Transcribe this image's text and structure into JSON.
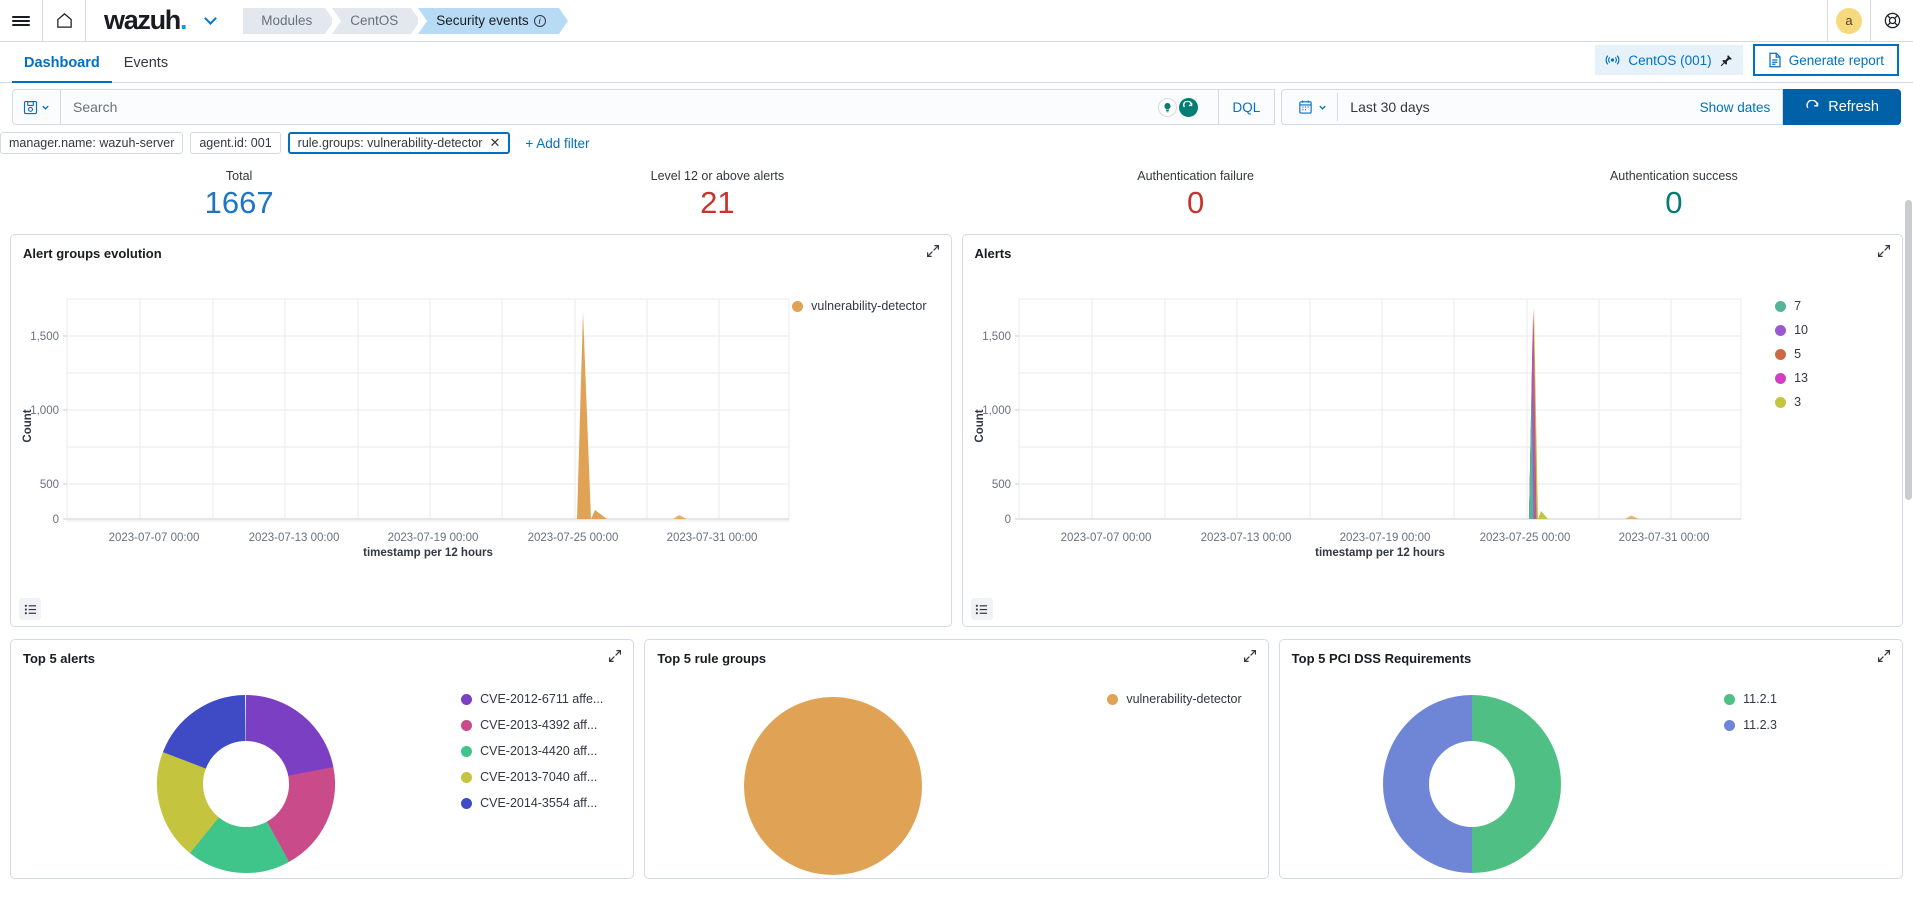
{
  "topnav": {
    "menu_icon": "hamburger-menu-icon",
    "home_icon": "home-icon",
    "brand": "wazuh",
    "brand_dot": ".",
    "breadcrumbs": [
      {
        "label": "Modules",
        "active": false
      },
      {
        "label": "CentOS",
        "active": false
      },
      {
        "label": "Security events",
        "active": true,
        "info": true
      }
    ],
    "avatar_initial": "a",
    "help_icon": "help-lifebuoy-icon"
  },
  "tabs": [
    {
      "label": "Dashboard",
      "active": true
    },
    {
      "label": "Events",
      "active": false
    }
  ],
  "agent_pill": {
    "label": "CentOS (001)",
    "icon": "agent-signal-icon",
    "pin_icon": "pin-icon"
  },
  "generate_report": {
    "label": "Generate report",
    "icon": "report-document-icon"
  },
  "query": {
    "saved_query_icon": "saved-query-disk-icon",
    "saved_query_chevron": "chevron-down-icon",
    "search_value": "",
    "search_placeholder": "Search",
    "lightbulb_icon": "lightbulb-icon",
    "refresh-circle_icon": "sync-circle-icon",
    "language": "DQL",
    "calendar_icon": "calendar-icon",
    "date_range": "Last 30 days",
    "show_dates": "Show dates",
    "refresh_label": "Refresh",
    "refresh_icon": "refresh-icon"
  },
  "filters": [
    {
      "label": "manager.name: wazuh-server",
      "focused": false,
      "removable": false
    },
    {
      "label": "agent.id: 001",
      "focused": false,
      "removable": false
    },
    {
      "label": "rule.groups: vulnerability-detector",
      "focused": true,
      "removable": true
    }
  ],
  "add_filter": "+ Add filter",
  "kpis": [
    {
      "label": "Total",
      "value": "1667",
      "color": "#1e75c6"
    },
    {
      "label": "Level 12 or above alerts",
      "value": "21",
      "color": "#c9332d"
    },
    {
      "label": "Authentication failure",
      "value": "0",
      "color": "#c9332d"
    },
    {
      "label": "Authentication success",
      "value": "0",
      "color": "#017d73"
    }
  ],
  "panels": {
    "alert_groups_evolution": {
      "title": "Alert groups evolution"
    },
    "alerts": {
      "title": "Alerts"
    },
    "top5_alerts": {
      "title": "Top 5 alerts"
    },
    "top5_rule_groups": {
      "title": "Top 5 rule groups"
    },
    "top5_pci_dss": {
      "title": "Top 5 PCI DSS Requirements"
    }
  },
  "chart_data": [
    {
      "id": "alert_groups_evolution",
      "type": "area",
      "title": "Alert groups evolution",
      "xlabel": "timestamp per 12 hours",
      "ylabel": "Count",
      "ylim": [
        0,
        1750
      ],
      "yticks": [
        "0",
        "500",
        "1,000",
        "1,500"
      ],
      "ytick_values": [
        0,
        500,
        1000,
        1500
      ],
      "xticks": [
        "2023-07-07 00:00",
        "2023-07-13 00:00",
        "2023-07-19 00:00",
        "2023-07-25 00:00",
        "2023-07-31 00:00"
      ],
      "grid": true,
      "legend_position": "top-right",
      "series": [
        {
          "name": "vulnerability-detector",
          "color": "#e0a255",
          "x": [
            "2023-07-04",
            "2023-07-10",
            "2023-07-16",
            "2023-07-22",
            "2023-07-26",
            "2023-07-26.5",
            "2023-07-27",
            "2023-07-28",
            "2023-07-31",
            "2023-08-02"
          ],
          "values": [
            0,
            0,
            0,
            0,
            0,
            1600,
            300,
            30,
            12,
            0
          ]
        }
      ]
    },
    {
      "id": "alerts",
      "type": "area",
      "title": "Alerts",
      "xlabel": "timestamp per 12 hours",
      "ylabel": "Count",
      "ylim": [
        0,
        1750
      ],
      "yticks": [
        "0",
        "500",
        "1,000",
        "1,500"
      ],
      "ytick_values": [
        0,
        500,
        1000,
        1500
      ],
      "xticks": [
        "2023-07-07 00:00",
        "2023-07-13 00:00",
        "2023-07-19 00:00",
        "2023-07-25 00:00",
        "2023-07-31 00:00"
      ],
      "grid": true,
      "legend_position": "right",
      "series": [
        {
          "name": "7",
          "color": "#54b399",
          "peak": 800
        },
        {
          "name": "10",
          "color": "#9b59d0",
          "peak": 1200
        },
        {
          "name": "5",
          "color": "#ca6b43",
          "peak": 1400
        },
        {
          "name": "13",
          "color": "#d13fc4",
          "peak": 1500
        },
        {
          "name": "3",
          "color": "#c5c43f",
          "peak": 1600
        }
      ]
    },
    {
      "id": "top5_alerts",
      "type": "pie",
      "title": "Top 5 alerts",
      "legend_position": "right",
      "labels": [
        "CVE-2012-6711 affe...",
        "CVE-2013-4392 aff...",
        "CVE-2013-4420 aff...",
        "CVE-2013-7040 aff...",
        "CVE-2014-3554 aff..."
      ],
      "colors": [
        "#7b3fc4",
        "#c94b8a",
        "#3fc48a",
        "#c5c43f",
        "#3f4bc4"
      ],
      "values": [
        22,
        20,
        19,
        20,
        19
      ]
    },
    {
      "id": "top5_rule_groups",
      "type": "pie",
      "title": "Top 5 rule groups",
      "legend_position": "right",
      "labels": [
        "vulnerability-detector"
      ],
      "colors": [
        "#e0a255"
      ],
      "values": [
        100
      ]
    },
    {
      "id": "top5_pci_dss",
      "type": "pie",
      "title": "Top 5 PCI DSS Requirements",
      "legend_position": "right",
      "labels": [
        "11.2.1",
        "11.2.3"
      ],
      "colors": [
        "#4fbf84",
        "#6f85d6"
      ],
      "values": [
        50,
        50
      ]
    }
  ]
}
